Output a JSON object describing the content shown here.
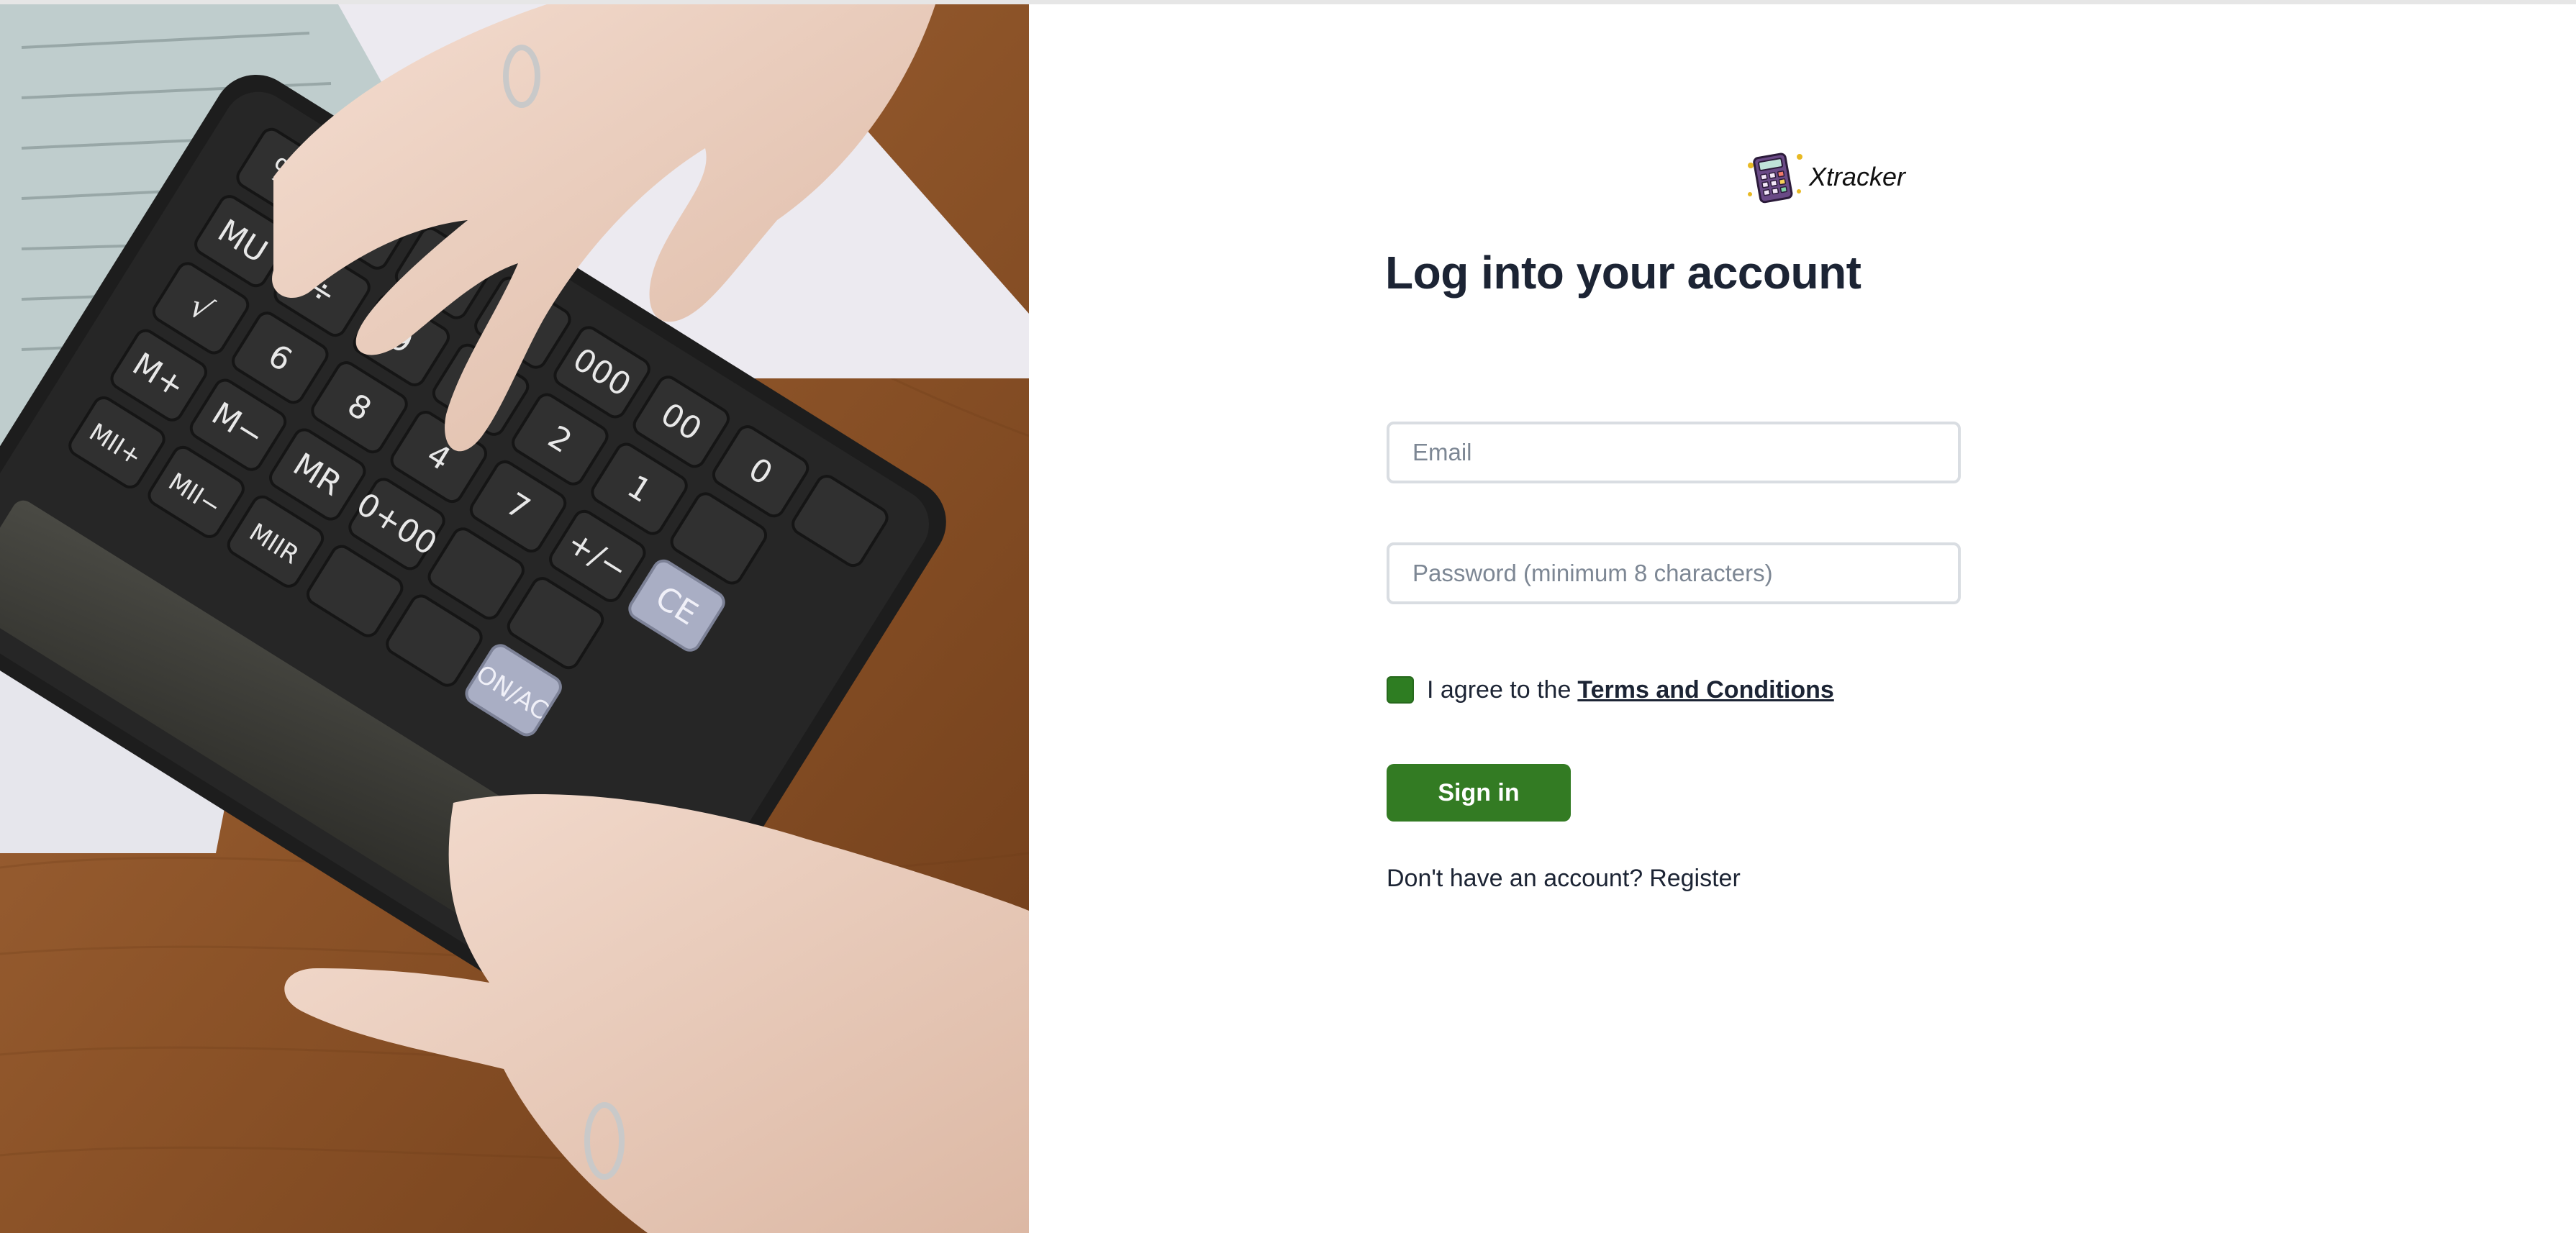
{
  "brand": {
    "name": "Xtracker",
    "logo_icon": "calculator-icon"
  },
  "login": {
    "title": "Log into your account",
    "email_placeholder": "Email",
    "email_value": "",
    "password_placeholder": "Password (minimum 8 characters)",
    "password_value": "",
    "agree_prefix": "I agree to the",
    "terms_label": "Terms and Conditions",
    "agree_checked": true,
    "signin_label": "Sign in",
    "register_prompt": "Don't have an account?",
    "register_label": "Register"
  },
  "photo": {
    "subject": "hands-using-calculator",
    "key_labels": [
      "%",
      "×",
      "÷",
      "−",
      "+",
      "MU",
      "√",
      "9",
      "6",
      "5",
      "2",
      "000",
      "00",
      "0",
      "1",
      "4",
      "8",
      "7",
      "M+",
      "M−",
      "MR",
      "+/−",
      "CE",
      "ON/AC",
      "0+00",
      "MII+",
      "MII−",
      "MIIR"
    ]
  },
  "colors": {
    "accent_green": "#337b23",
    "checkbox_green": "#2e7d22",
    "heading_text": "#1c2434",
    "field_border": "#d9dde2",
    "placeholder_text": "#7d8794"
  }
}
